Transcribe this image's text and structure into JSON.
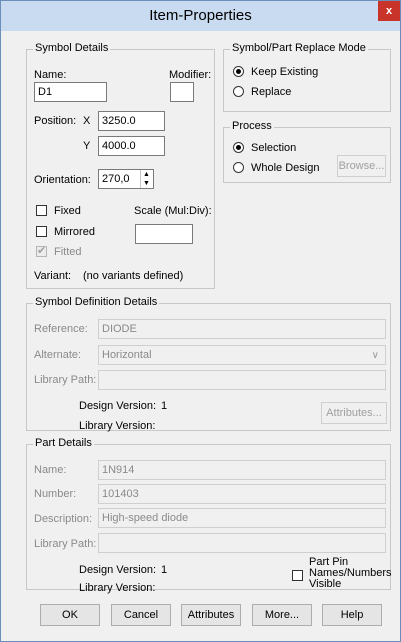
{
  "window": {
    "title": "Item-Properties",
    "close_glyph": "x"
  },
  "symbol_details": {
    "title": "Symbol Details",
    "name_label": "Name:",
    "name_value": "D1",
    "modifier_label": "Modifier:",
    "modifier_value": "",
    "position_label": "Position:",
    "x_label": "X",
    "x_value": "3250.0",
    "y_label": "Y",
    "y_value": "4000.0",
    "orientation_label": "Orientation:",
    "orientation_value": "270,0",
    "fixed_label": "Fixed",
    "mirrored_label": "Mirrored",
    "fitted_label": "Fitted",
    "scale_label": "Scale (Mul:Div):",
    "scale_value": "",
    "variant_label": "Variant:",
    "variant_value": "(no variants defined)"
  },
  "replace_mode": {
    "title": "Symbol/Part Replace Mode",
    "keep_existing": "Keep Existing",
    "replace": "Replace"
  },
  "process": {
    "title": "Process",
    "selection": "Selection",
    "whole_design": "Whole Design",
    "browse": "Browse..."
  },
  "symbol_definition": {
    "title": "Symbol Definition Details",
    "reference_label": "Reference:",
    "reference_value": "DIODE",
    "alternate_label": "Alternate:",
    "alternate_value": "Horizontal",
    "library_path_label": "Library Path:",
    "library_path_value": "",
    "design_version_label": "Design Version:",
    "design_version_value": "1",
    "library_version_label": "Library Version:",
    "attributes_button": "Attributes..."
  },
  "part_details": {
    "title": "Part Details",
    "name_label": "Name:",
    "name_value": "1N914",
    "number_label": "Number:",
    "number_value": "101403",
    "description_label": "Description:",
    "description_value": "High-speed diode",
    "library_path_label": "Library Path:",
    "library_path_value": "",
    "design_version_label": "Design Version:",
    "design_version_value": "1",
    "library_version_label": "Library Version:",
    "pin_names_line1": "Part Pin",
    "pin_names_line2": "Names/Numbers",
    "pin_names_line3": "Visible"
  },
  "buttons": {
    "ok": "OK",
    "cancel": "Cancel",
    "attributes": "Attributes",
    "more": "More...",
    "help": "Help"
  },
  "colors": {
    "titlebar": "#c9dbf0",
    "close": "#c9342a",
    "window_bg": "#f0f0f0"
  }
}
